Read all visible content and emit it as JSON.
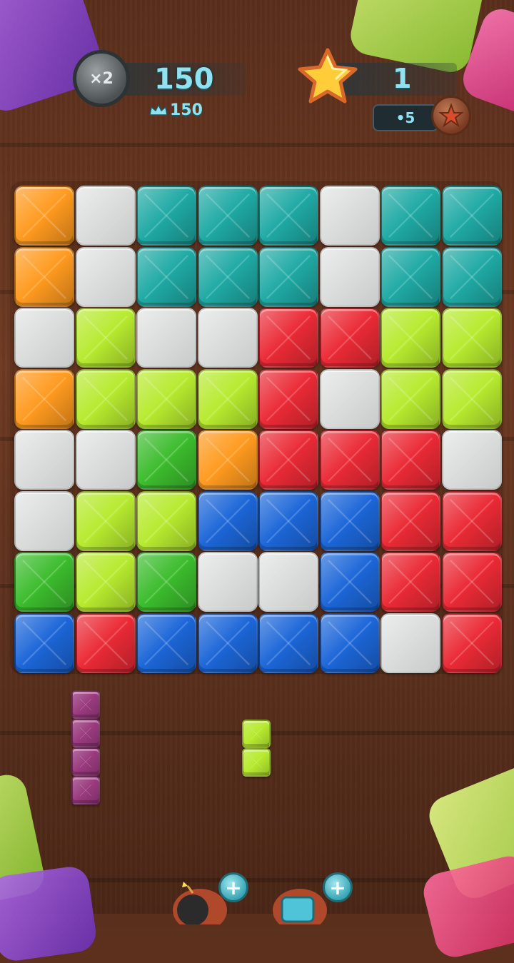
{
  "header": {
    "multiplier": "×2",
    "score": "150",
    "best_score": "150",
    "stars": "1",
    "coins": "•5"
  },
  "colors": {
    "O": "#ff9a1f",
    "T": "#1fa9a4",
    "E": null,
    "L": "#b7ea2f",
    "R": "#ea2a35",
    "G": "#3cbc2d",
    "B": "#1c66d8",
    "P": "#9a3b7e"
  },
  "icons": {
    "multiplier": "coin-multiplier-icon",
    "crown": "crown-icon",
    "star": "star-icon",
    "coin": "coin-icon",
    "bomb": "bomb-icon",
    "hammer": "hammer-icon",
    "plus": "plus-icon"
  },
  "board": {
    "rows": [
      [
        "O",
        "E",
        "T",
        "T",
        "T",
        "E",
        "T",
        "T"
      ],
      [
        "O",
        "E",
        "T",
        "T",
        "T",
        "E",
        "T",
        "T"
      ],
      [
        "E",
        "L",
        "E",
        "E",
        "R",
        "R",
        "L",
        "L"
      ],
      [
        "O",
        "L",
        "L",
        "L",
        "R",
        "E",
        "L",
        "L"
      ],
      [
        "E",
        "E",
        "G",
        "O",
        "R",
        "R",
        "R",
        "E"
      ],
      [
        "E",
        "L",
        "L",
        "B",
        "B",
        "B",
        "R",
        "R"
      ],
      [
        "G",
        "L",
        "G",
        "E",
        "E",
        "B",
        "R",
        "R"
      ],
      [
        "B",
        "R",
        "B",
        "B",
        "B",
        "B",
        "E",
        "R"
      ]
    ]
  },
  "tray": {
    "pieces": [
      {
        "color": "P",
        "cells": [
          [
            0,
            0
          ],
          [
            0,
            1
          ],
          [
            0,
            2
          ],
          [
            0,
            3
          ]
        ]
      },
      {
        "color": "L",
        "cells": [
          [
            0,
            0
          ],
          [
            0,
            1
          ]
        ]
      }
    ]
  }
}
